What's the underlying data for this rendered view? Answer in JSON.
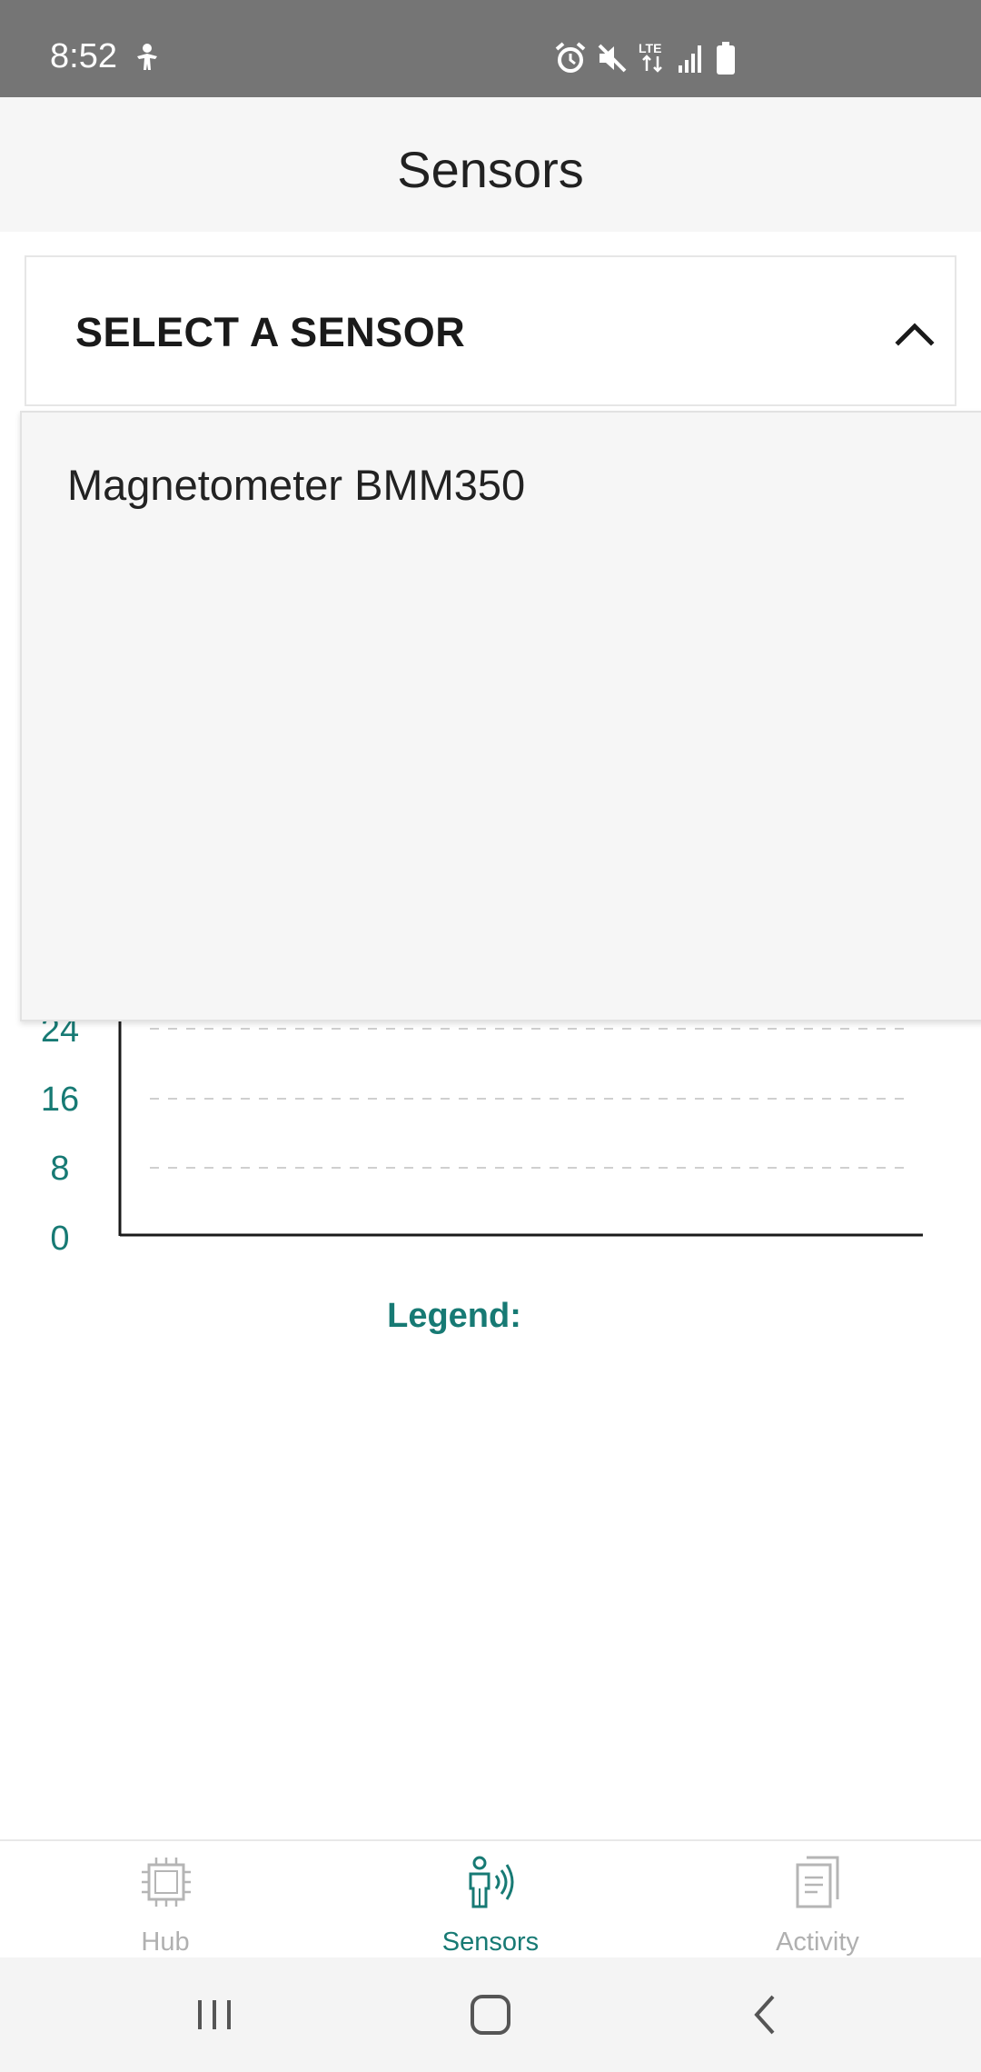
{
  "status_bar": {
    "time": "8:52",
    "icons": [
      "accessibility-icon",
      "alarm-icon",
      "mute-icon",
      "lte-icon",
      "signal-icon",
      "battery-icon"
    ],
    "network_label": "LTE"
  },
  "header": {
    "title": "Sensors"
  },
  "sensor_select": {
    "label": "SELECT A SENSOR",
    "expanded": true,
    "options": [
      "Magnetometer BMM350"
    ]
  },
  "chart": {
    "y_ticks_visible": [
      "24",
      "16",
      "8",
      "0"
    ],
    "legend_label": "Legend:"
  },
  "chart_data": {
    "type": "line",
    "title": "",
    "xlabel": "",
    "ylabel": "",
    "y_ticks": [
      0,
      8,
      16,
      24
    ],
    "grid": "dashed horizontal",
    "series": []
  },
  "bottom_nav": {
    "items": [
      {
        "label": "Hub",
        "icon": "chip-icon",
        "active": false
      },
      {
        "label": "Sensors",
        "icon": "person-sensor-icon",
        "active": true
      },
      {
        "label": "Activity",
        "icon": "documents-icon",
        "active": false
      }
    ]
  },
  "system_nav": {
    "buttons": [
      "recents-icon",
      "home-icon",
      "back-icon"
    ]
  },
  "colors": {
    "accent": "#177a74",
    "status_bar": "#757575",
    "header_bg": "#f6f6f6",
    "inactive_nav": "#b0b0b0"
  }
}
